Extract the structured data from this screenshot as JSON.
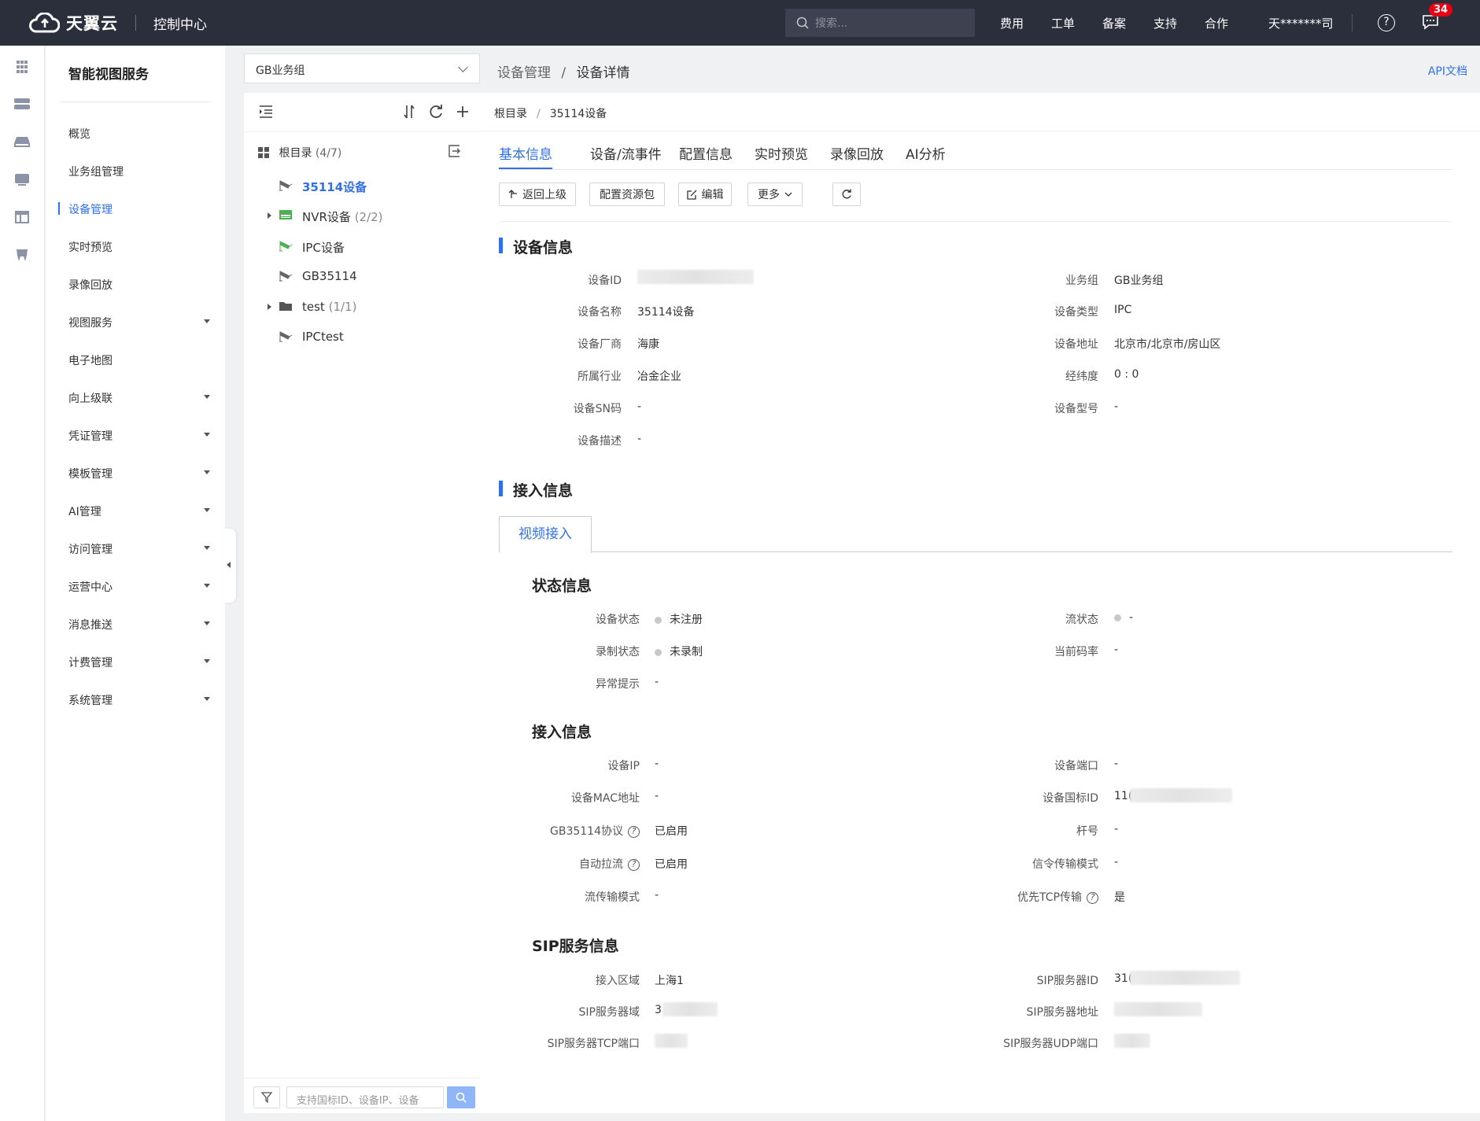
{
  "topbar": {
    "brand": "天翼云",
    "console": "控制中心",
    "search_placeholder": "搜索...",
    "nav": [
      "费用",
      "工单",
      "备案",
      "支持",
      "合作"
    ],
    "user": "天*******司",
    "badge": "34",
    "help": "?"
  },
  "sidebar": {
    "title": "智能视图服务",
    "items": [
      {
        "label": "概览"
      },
      {
        "label": "业务组管理"
      },
      {
        "label": "设备管理"
      },
      {
        "label": "实时预览"
      },
      {
        "label": "录像回放"
      },
      {
        "label": "视图服务"
      },
      {
        "label": "电子地图"
      },
      {
        "label": "向上级联"
      },
      {
        "label": "凭证管理"
      },
      {
        "label": "模板管理"
      },
      {
        "label": "AI管理"
      },
      {
        "label": "访问管理"
      },
      {
        "label": "运营中心"
      },
      {
        "label": "消息推送"
      },
      {
        "label": "计费管理"
      },
      {
        "label": "系统管理"
      }
    ],
    "active_item": "设备管理"
  },
  "group_select": {
    "value": "GB业务组"
  },
  "tree": {
    "root_label": "根目录",
    "root_count": "(4/7)",
    "nodes": [
      {
        "label": "35114设备",
        "count": ""
      },
      {
        "label": "NVR设备",
        "count": "(2/2)"
      },
      {
        "label": "IPC设备",
        "count": ""
      },
      {
        "label": "GB35114",
        "count": ""
      },
      {
        "label": "test",
        "count": "(1/1)"
      },
      {
        "label": "IPCtest",
        "count": ""
      }
    ],
    "search_placeholder": "支持国标ID、设备IP、设备"
  },
  "page_breadcrumb": {
    "parent": "设备管理",
    "separator": "/",
    "current": "设备详情"
  },
  "api_doc": "API文档",
  "content_breadcrumb": {
    "root": "根目录",
    "separator": "/",
    "current": "35114设备"
  },
  "tabs": [
    "基本信息",
    "设备/流事件",
    "配置信息",
    "实时预览",
    "录像回放",
    "AI分析"
  ],
  "actions": {
    "back": "返回上级",
    "config": "配置资源包",
    "edit": "编辑",
    "more": "更多"
  },
  "device_info": {
    "title": "设备信息",
    "fields": {
      "id": {
        "label": "设备ID",
        "value": ""
      },
      "group": {
        "label": "业务组",
        "value": "GB业务组"
      },
      "name": {
        "label": "设备名称",
        "value": "35114设备"
      },
      "type": {
        "label": "设备类型",
        "value": "IPC"
      },
      "vendor": {
        "label": "设备厂商",
        "value": "海康"
      },
      "address": {
        "label": "设备地址",
        "value": "北京市/北京市/房山区"
      },
      "industry": {
        "label": "所属行业",
        "value": "冶金企业"
      },
      "latlng": {
        "label": "经纬度",
        "value": "0 : 0"
      },
      "sn": {
        "label": "设备SN码",
        "value": "-"
      },
      "model": {
        "label": "设备型号",
        "value": "-"
      },
      "desc": {
        "label": "设备描述",
        "value": "-"
      }
    }
  },
  "access": {
    "title": "接入信息",
    "subtab": "视频接入",
    "status": {
      "title": "状态信息",
      "device_status": {
        "label": "设备状态",
        "value": "未注册"
      },
      "stream_status": {
        "label": "流状态",
        "value": "-"
      },
      "record_status": {
        "label": "录制状态",
        "value": "未录制"
      },
      "bitrate": {
        "label": "当前码率",
        "value": "-"
      },
      "alert": {
        "label": "异常提示",
        "value": "-"
      }
    },
    "conn": {
      "title": "接入信息",
      "ip": {
        "label": "设备IP",
        "value": "-"
      },
      "port": {
        "label": "设备端口",
        "value": "-"
      },
      "mac": {
        "label": "设备MAC地址",
        "value": "-"
      },
      "gbid": {
        "label": "设备国标ID",
        "value": "11("
      },
      "gb35114": {
        "label": "GB35114协议",
        "value": "已启用"
      },
      "pole": {
        "label": "杆号",
        "value": "-"
      },
      "autopull": {
        "label": "自动拉流",
        "value": "已启用"
      },
      "signal": {
        "label": "信令传输模式",
        "value": "-"
      },
      "streammode": {
        "label": "流传输模式",
        "value": "-"
      },
      "tcp": {
        "label": "优先TCP传输",
        "value": "是"
      }
    },
    "sip": {
      "title": "SIP服务信息",
      "region": {
        "label": "接入区域",
        "value": "上海1"
      },
      "server_id": {
        "label": "SIP服务器ID",
        "value": "31("
      },
      "domain": {
        "label": "SIP服务器域",
        "value": "3"
      },
      "address": {
        "label": "SIP服务器地址",
        "value": ""
      },
      "tcp_port": {
        "label": "SIP服务器TCP端口",
        "value": ""
      },
      "udp_port": {
        "label": "SIP服务器UDP端口",
        "value": ""
      }
    }
  },
  "colors": {
    "accent": "#3370e6",
    "topbar": "#2b2e3b",
    "badge": "#e60012",
    "tree_icon_green": "#4caf50"
  }
}
